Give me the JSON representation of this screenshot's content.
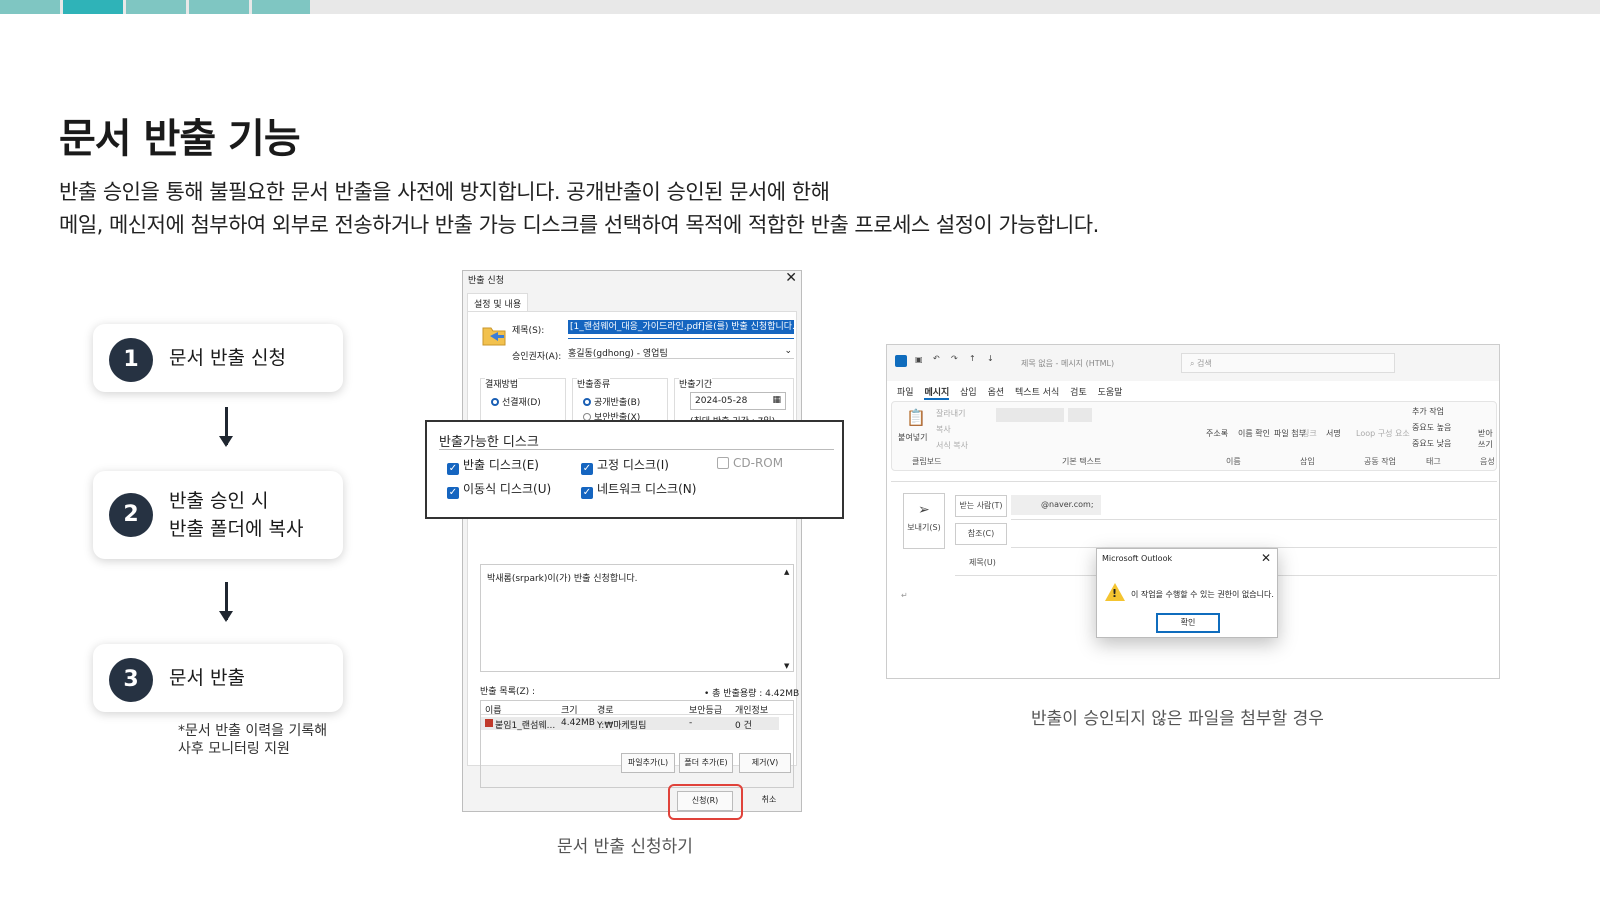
{
  "colors": {
    "teal": "#7fc6c2",
    "teal_dark": "#2fb3b8",
    "bar_bg": "#e8e8e8",
    "num_bg": "#263242",
    "highlight_red": "#e0423a",
    "accent_blue": "#1565c0"
  },
  "title": "문서 반출 기능",
  "description": [
    "반출 승인을 통해 불필요한 문서 반출을 사전에 방지합니다. 공개반출이 승인된 문서에 한해",
    "메일, 메신저에 첨부하여 외부로 전송하거나 반출 가능 디스크를 선택하여 목적에 적합한 반출 프로세스 설정이 가능합니다."
  ],
  "steps": [
    {
      "num": "1",
      "line1": "문서 반출 신청",
      "line2": ""
    },
    {
      "num": "2",
      "line1": "반출 승인 시",
      "line2": "반출 폴더에 복사"
    },
    {
      "num": "3",
      "line1": "문서 반출",
      "line2": ""
    }
  ],
  "note": [
    "*문서 반출 이력을 기록해",
    "사후 모니터링 지원"
  ],
  "dialog": {
    "title": "반출 신청",
    "tab": "설정 및 내용",
    "subject_label": "제목(S):",
    "subject_value": "[1_랜섬웨어_대응_가이드라인.pdf]을(를) 반출 신청합니다.",
    "approver_label": "승인권자(A):",
    "approver_value": "홍길동(gdhong) - 영업팀",
    "payment_label": "결재방법",
    "payment_option": "선결재(D)",
    "type_label": "반출종류",
    "type_public": "공개반출(B)",
    "type_secure": "보안반출(X)",
    "period_label": "반출기간",
    "period_date": "2024-05-28",
    "period_hint": "(최대 반출 기간 : 7일)",
    "message": "박새롬(srpark)이(가) 반출 신청합니다.",
    "list_label": "반출 목록(Z) :",
    "total_size": "• 총 반출용량 : 4.42MB",
    "list_headers": [
      "이름",
      "크기",
      "경로",
      "보안등급",
      "개인정보"
    ],
    "list_row": [
      "붙임1_랜섬웨...",
      "4.42MB",
      "Y:₩마케팅팀",
      "-",
      "0 건"
    ],
    "btn_add_file": "파일추가(L)",
    "btn_add_folder": "폴더 추가(E)",
    "btn_remove": "제거(V)",
    "btn_apply": "신청(R)",
    "btn_cancel": "취소"
  },
  "disks": {
    "title": "반출가능한 디스크",
    "items": [
      {
        "label": "반출 디스크(E)",
        "checked": true
      },
      {
        "label": "고정 디스크(I)",
        "checked": true
      },
      {
        "label": "CD-ROM",
        "checked": false
      },
      {
        "label": "이동식 디스크(U)",
        "checked": true
      },
      {
        "label": "네트워크 디스크(N)",
        "checked": true
      }
    ]
  },
  "caption_left": "문서 반출 신청하기",
  "caption_right": "반출이 승인되지 않은 파일을 첨부할 경우",
  "outlook": {
    "window_title": "제목 없음 - 메시지 (HTML)",
    "search": "검색",
    "menu": [
      "파일",
      "메시지",
      "삽입",
      "옵션",
      "텍스트 서식",
      "검토",
      "도움말"
    ],
    "ribbon_groups": [
      "클립보드",
      "기본 텍스트",
      "이름",
      "삽입",
      "공동 작업",
      "태그",
      "음성"
    ],
    "ribbon_items": [
      "붙여넣기",
      "잘라내기",
      "복사",
      "서식 복사",
      "주소록",
      "이름 확인",
      "파일 첨부",
      "링크",
      "서명",
      "Loop 구성 요소",
      "추가 작업",
      "중요도 높음",
      "중요도 낮음",
      "받아쓰기"
    ],
    "send": "보내기(S)",
    "to": "받는 사람(T)",
    "cc": "참조(C)",
    "subject": "제목(U)",
    "to_value": "@naver.com;",
    "dialog_title": "Microsoft Outlook",
    "dialog_message": "이 작업을 수행할 수 있는 권한이 없습니다.",
    "dialog_ok": "확인"
  }
}
